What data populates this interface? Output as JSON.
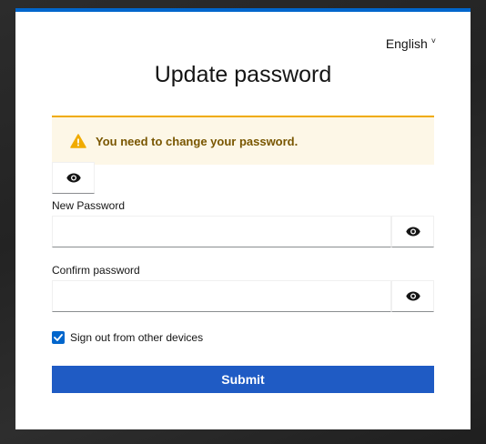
{
  "language": {
    "label": "English",
    "chevron_icon": "chevron-down-icon"
  },
  "page": {
    "title": "Update password"
  },
  "alert": {
    "icon": "warning-triangle-icon",
    "text": "You need to change your password.",
    "accent_color": "#f0ab00",
    "text_color": "#795600"
  },
  "fields": {
    "new_password": {
      "label": "New Password",
      "value": "",
      "toggle_icon": "eye-icon"
    },
    "confirm_password": {
      "label": "Confirm password",
      "value": "",
      "toggle_icon": "eye-icon"
    }
  },
  "sign_out_other_devices": {
    "label": "Sign out from other devices",
    "checked": true
  },
  "submit": {
    "label": "Submit",
    "color": "#1f5bc4"
  },
  "theme": {
    "primary": "#0066cc"
  }
}
